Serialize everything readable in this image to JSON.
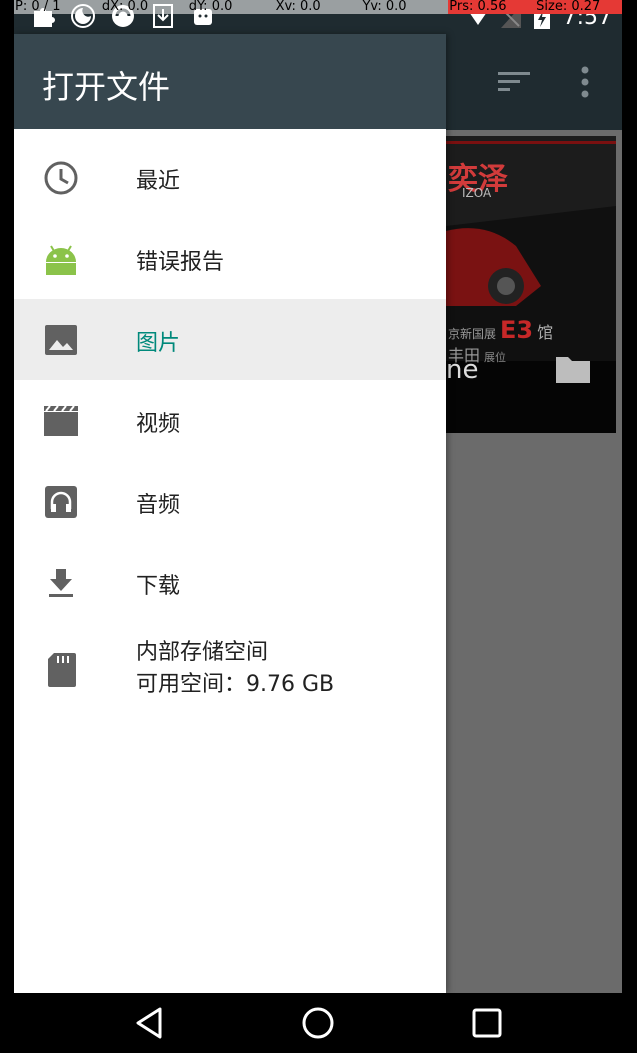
{
  "status_bar": {
    "time": "7:57",
    "debug": {
      "p": "P: 0 / 1",
      "dx": "dX: 0.0",
      "dy": "dY: 0.0",
      "xv": "Xv: 0.0",
      "yv": "Yv: 0.0",
      "prs": "Prs: 0.56",
      "size": "Size: 0.27"
    }
  },
  "drawer": {
    "title": "打开文件",
    "items": [
      {
        "label": "最近",
        "icon": "clock-icon"
      },
      {
        "label": "错误报告",
        "icon": "android-icon"
      },
      {
        "label": "图片",
        "icon": "image-icon"
      },
      {
        "label": "视频",
        "icon": "video-icon"
      },
      {
        "label": "音频",
        "icon": "headphones-icon"
      },
      {
        "label": "下载",
        "icon": "download-icon"
      }
    ],
    "storage": {
      "name": "内部存储空间",
      "free": "可用空间：9.76 GB",
      "icon": "sd-card-icon"
    }
  },
  "background": {
    "tile_title": "ne",
    "tile_text_top": "奕泽",
    "tile_text_sub": "IZOA",
    "tile_text_mid": "京新国展",
    "tile_text_e3": "E3",
    "tile_text_hall": "馆",
    "tile_text_bottom": "丰田",
    "tile_text_booth": "展位"
  },
  "colors": {
    "accent": "#00897b",
    "drawer_header": "#37474f",
    "app_bar": "#1f2b30",
    "icon_gray": "#616161",
    "android_green": "#8bc34a"
  }
}
